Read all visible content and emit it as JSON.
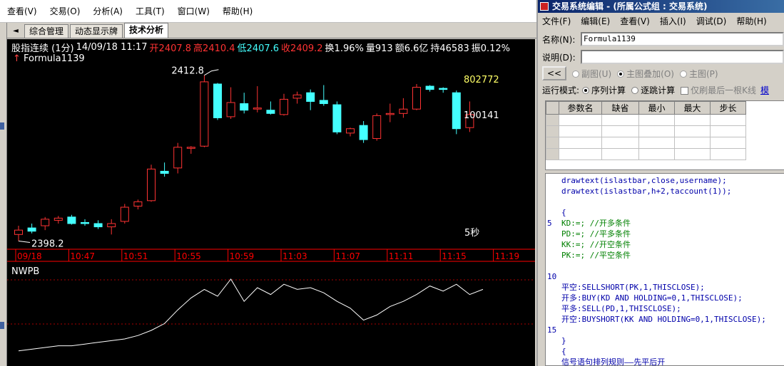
{
  "left_app": {
    "menu": [
      "查看(V)",
      "交易(O)",
      "分析(A)",
      "工具(T)",
      "窗口(W)",
      "帮助(H)"
    ],
    "tabs": {
      "arrow": "◄",
      "items": [
        "综合管理",
        "动态显示牌",
        "技术分析"
      ],
      "active_index": 2
    },
    "info": {
      "instrument": "股指连续 (1分)",
      "datetime": "14/09/18 11:17",
      "open": "开2407.8",
      "high": "高2410.4",
      "low": "低2407.6",
      "close": "收2409.2",
      "turnover": "换1.96%",
      "volume": "量913",
      "amount": "额6.6亿",
      "open_interest": "持46583",
      "amplitude": "振0.12%"
    },
    "formula": {
      "arrow": "↑",
      "name": "Formula1139"
    },
    "chart": {
      "high_label": "2412.8",
      "low_label": "2398.2",
      "username_label": "802772",
      "account_label": "100141",
      "timer_label": "5秒",
      "time_axis": [
        "09/18",
        "10:47",
        "10:51",
        "10:55",
        "10:59",
        "11:03",
        "11:07",
        "11:11",
        "11:15",
        "11:19"
      ],
      "indicator_name": "NWPB",
      "colors": {
        "up": "#ff3333",
        "down": "#44ffff",
        "axis": "#ff0000",
        "grid": "#aa0000",
        "line": "#ffffff",
        "high_text": "#ffffff",
        "username": "#ffff66"
      }
    }
  },
  "chart_data": {
    "type": "candlestick",
    "ylim": [
      2397.5,
      2413.5
    ],
    "candles": [
      {
        "o": 2398.2,
        "h": 2399.0,
        "l": 2397.6,
        "c": 2398.6
      },
      {
        "o": 2398.8,
        "h": 2399.2,
        "l": 2398.3,
        "c": 2398.5
      },
      {
        "o": 2399.0,
        "h": 2399.8,
        "l": 2398.6,
        "c": 2399.6
      },
      {
        "o": 2399.5,
        "h": 2399.9,
        "l": 2399.2,
        "c": 2399.7
      },
      {
        "o": 2399.8,
        "h": 2400.0,
        "l": 2399.1,
        "c": 2399.2
      },
      {
        "o": 2399.3,
        "h": 2399.6,
        "l": 2399.0,
        "c": 2399.2
      },
      {
        "o": 2399.2,
        "h": 2399.5,
        "l": 2398.7,
        "c": 2398.9
      },
      {
        "o": 2398.9,
        "h": 2399.6,
        "l": 2398.2,
        "c": 2399.2
      },
      {
        "o": 2399.4,
        "h": 2401.0,
        "l": 2399.2,
        "c": 2400.7
      },
      {
        "o": 2400.8,
        "h": 2401.4,
        "l": 2400.5,
        "c": 2401.2
      },
      {
        "o": 2401.3,
        "h": 2404.6,
        "l": 2401.2,
        "c": 2404.2
      },
      {
        "o": 2404.0,
        "h": 2404.8,
        "l": 2403.5,
        "c": 2403.8
      },
      {
        "o": 2404.3,
        "h": 2406.6,
        "l": 2403.8,
        "c": 2406.2
      },
      {
        "o": 2406.1,
        "h": 2406.3,
        "l": 2405.6,
        "c": 2406.2
      },
      {
        "o": 2406.3,
        "h": 2412.8,
        "l": 2406.2,
        "c": 2412.2
      },
      {
        "o": 2412.0,
        "h": 2412.1,
        "l": 2408.7,
        "c": 2408.9
      },
      {
        "o": 2409.0,
        "h": 2411.7,
        "l": 2408.8,
        "c": 2410.3
      },
      {
        "o": 2410.2,
        "h": 2411.2,
        "l": 2409.3,
        "c": 2409.6
      },
      {
        "o": 2409.7,
        "h": 2411.8,
        "l": 2409.4,
        "c": 2409.8
      },
      {
        "o": 2409.6,
        "h": 2410.4,
        "l": 2409.2,
        "c": 2409.3
      },
      {
        "o": 2409.2,
        "h": 2411.1,
        "l": 2409.1,
        "c": 2410.6
      },
      {
        "o": 2410.7,
        "h": 2411.3,
        "l": 2410.2,
        "c": 2411.0
      },
      {
        "o": 2411.2,
        "h": 2411.5,
        "l": 2409.6,
        "c": 2410.4
      },
      {
        "o": 2410.5,
        "h": 2411.9,
        "l": 2410.0,
        "c": 2410.2
      },
      {
        "o": 2410.1,
        "h": 2410.4,
        "l": 2407.4,
        "c": 2407.6
      },
      {
        "o": 2407.5,
        "h": 2408.0,
        "l": 2407.2,
        "c": 2407.9
      },
      {
        "o": 2408.2,
        "h": 2408.6,
        "l": 2406.6,
        "c": 2406.9
      },
      {
        "o": 2407.0,
        "h": 2409.3,
        "l": 2406.8,
        "c": 2409.1
      },
      {
        "o": 2409.2,
        "h": 2410.2,
        "l": 2408.5,
        "c": 2409.3
      },
      {
        "o": 2409.3,
        "h": 2410.7,
        "l": 2408.9,
        "c": 2409.7
      },
      {
        "o": 2409.7,
        "h": 2412.0,
        "l": 2409.6,
        "c": 2411.7
      },
      {
        "o": 2411.8,
        "h": 2411.9,
        "l": 2411.3,
        "c": 2411.5
      },
      {
        "o": 2411.6,
        "h": 2411.7,
        "l": 2411.2,
        "c": 2411.5
      },
      {
        "o": 2411.2,
        "h": 2411.4,
        "l": 2407.4,
        "c": 2407.9
      },
      {
        "o": 2408.0,
        "h": 2410.4,
        "l": 2407.6,
        "c": 2409.2
      }
    ],
    "indicator": {
      "name": "NWPB",
      "ylim": [
        0,
        100
      ],
      "values": [
        6,
        8,
        10,
        12,
        12,
        14,
        16,
        18,
        20,
        24,
        30,
        38,
        54,
        68,
        78,
        70,
        90,
        64,
        80,
        72,
        84,
        78,
        80,
        74,
        64,
        56,
        42,
        48,
        58,
        64,
        72,
        82,
        76,
        84,
        72,
        78
      ]
    }
  },
  "editor": {
    "title": "交易系统编辑 - (所属公式组 : 交易系统)",
    "menu": [
      "文件(F)",
      "编辑(E)",
      "查看(V)",
      "插入(I)",
      "调试(D)",
      "帮助(H)"
    ],
    "name_label": "名称(N):",
    "name_value": "Formula1139",
    "desc_label": "说明(D):",
    "desc_value": "",
    "collapse_button": "<<",
    "options": [
      {
        "label": "副图(U)",
        "selected": false
      },
      {
        "label": "主图叠加(O)",
        "selected": true
      },
      {
        "label": "主图(P)",
        "selected": false
      }
    ],
    "run_mode_label": "运行模式:",
    "run_modes": [
      {
        "label": "序列计算",
        "selected": true
      },
      {
        "label": "逐跳计算",
        "selected": false
      }
    ],
    "last_bar_label": "仅刷最后一根K线",
    "overflow_label": "模",
    "param_columns": [
      "参数名",
      "缺省",
      "最小",
      "最大",
      "步长"
    ],
    "code_lines": [
      {
        "ln": "",
        "text": "drawtext(islastbar,close,username);",
        "style": "blue"
      },
      {
        "ln": "",
        "text": "drawtext(islastbar,h+2,taccount(1));",
        "style": "blue"
      },
      {
        "ln": "",
        "text": "",
        "style": "blue"
      },
      {
        "ln": "",
        "text": "{",
        "style": "blue"
      },
      {
        "ln": "5",
        "text": "KD:=;          //开多条件",
        "style": "green"
      },
      {
        "ln": "",
        "text": "PD:=;          //平多条件",
        "style": "green"
      },
      {
        "ln": "",
        "text": "KK:=;          //开空条件",
        "style": "green"
      },
      {
        "ln": "",
        "text": "PK:=;          //平空条件",
        "style": "green"
      },
      {
        "ln": "",
        "text": "",
        "style": "blue"
      },
      {
        "ln": "10",
        "text": "",
        "style": "blue"
      },
      {
        "ln": "",
        "text": "平空:SELLSHORT(PK,1,THISCLOSE);",
        "style": "blue"
      },
      {
        "ln": "",
        "text": "开多:BUY(KD AND HOLDING=0,1,THISCLOSE);",
        "style": "blue"
      },
      {
        "ln": "",
        "text": "平多:SELL(PD,1,THISCLOSE);",
        "style": "blue"
      },
      {
        "ln": "",
        "text": "开空:BUYSHORT(KK AND HOLDING=0,1,THISCLOSE);",
        "style": "blue"
      },
      {
        "ln": "15",
        "text": "",
        "style": "blue"
      },
      {
        "ln": "",
        "text": "}",
        "style": "blue"
      },
      {
        "ln": "",
        "text": "{",
        "style": "blue"
      },
      {
        "ln": "",
        "text": "信号语句排列规则——先平后开",
        "style": "blue"
      }
    ]
  }
}
